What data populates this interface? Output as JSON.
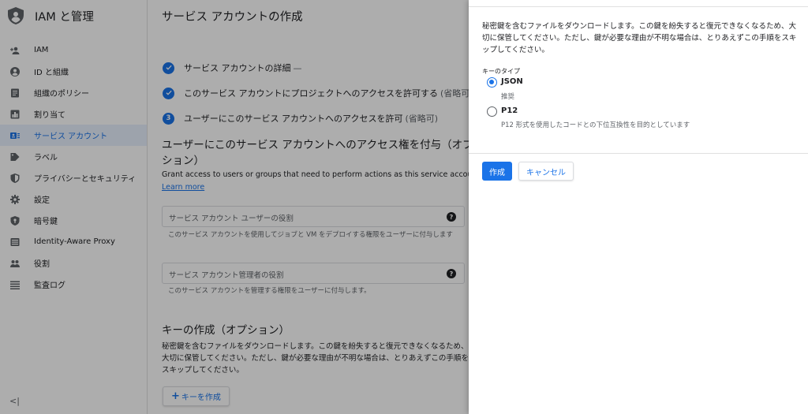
{
  "app": {
    "title": "IAM と管理"
  },
  "sidebar": {
    "items": [
      {
        "label": "IAM",
        "icon": "person-add-icon",
        "active": false
      },
      {
        "label": "ID と組織",
        "icon": "account-circle-icon",
        "active": false
      },
      {
        "label": "組織のポリシー",
        "icon": "policy-document-icon",
        "active": false
      },
      {
        "label": "割り当て",
        "icon": "quota-icon",
        "active": false
      },
      {
        "label": "サービス アカウント",
        "icon": "service-account-icon",
        "active": true
      },
      {
        "label": "ラベル",
        "icon": "label-icon",
        "active": false
      },
      {
        "label": "プライバシーとセキュリティ",
        "icon": "shield-icon",
        "active": false
      },
      {
        "label": "設定",
        "icon": "gear-icon",
        "active": false
      },
      {
        "label": "暗号鍵",
        "icon": "key-shield-icon",
        "active": false
      },
      {
        "label": "Identity-Aware Proxy",
        "icon": "proxy-icon",
        "active": false
      },
      {
        "label": "役割",
        "icon": "roles-icon",
        "active": false
      },
      {
        "label": "監査ログ",
        "icon": "list-icon",
        "active": false
      }
    ],
    "collapse_label": "<|"
  },
  "main": {
    "title": "サービス アカウントの作成",
    "steps": [
      {
        "status": "done",
        "label": "サービス アカウントの詳細",
        "suffix": "—"
      },
      {
        "status": "done",
        "label": "このサービス アカウントにプロジェクトへのアクセスを許可する",
        "suffix": "(省略可"
      },
      {
        "status": "current",
        "number": "3",
        "label": "ユーザーにこのサービス アカウントへのアクセスを許可",
        "suffix": "(省略可)"
      }
    ],
    "section_title": "ユーザーにこのサービス アカウントへのアクセス権を付与（オプション）",
    "section_desc": "Grant access to users or groups that need to perform actions as this service account.",
    "learn_more": "Learn more",
    "fields": [
      {
        "placeholder": "サービス アカウント ユーザーの役割",
        "hint": "このサービス アカウントを使用してジョブと VM をデプロイする権限をユーザーに付与します"
      },
      {
        "placeholder": "サービス アカウント管理者の役割",
        "hint": "このサービス アカウントを管理する権限をユーザーに付与します。"
      }
    ],
    "key_title": "キーの作成（オプション）",
    "key_desc": "秘密鍵を含むファイルをダウンロードします。この鍵を紛失すると復元できなくなるため、大切に保管してください。ただし、鍵が必要な理由が不明な場合は、とりあえずこの手順をスキップしてください。",
    "create_key_button": "キーを作成",
    "create_key_plus": "+"
  },
  "panel": {
    "desc": "秘密鍵を含むファイルをダウンロードします。この鍵を紛失すると復元できなくなるため、大切に保管してください。ただし、鍵が必要な理由が不明な場合は、とりあえずこの手順をスキップしてください。",
    "key_type_label": "キーのタイプ",
    "options": [
      {
        "label": "JSON",
        "sub": "推奨",
        "selected": true
      },
      {
        "label": "P12",
        "sub": "P12 形式を使用したコードとの下位互換性を目的としています",
        "selected": false
      }
    ],
    "create_button": "作成",
    "cancel_button": "キャンセル"
  },
  "colors": {
    "accent": "#1a73e8",
    "scrim": "rgba(0,0,0,0.32)"
  }
}
